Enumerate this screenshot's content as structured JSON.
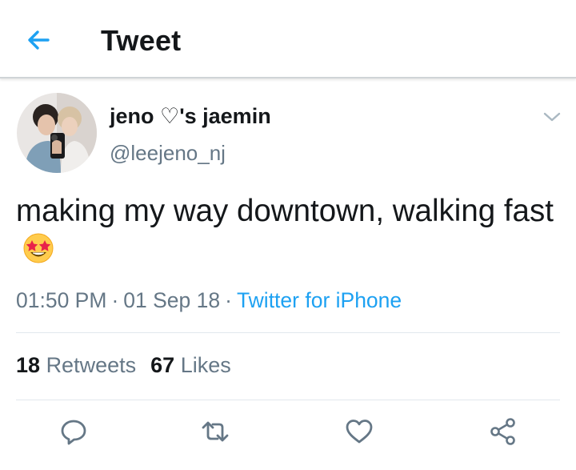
{
  "header": {
    "title": "Tweet",
    "back_icon": "arrow-left-icon",
    "accent_color": "#1da1f2"
  },
  "tweet": {
    "display_name": "jeno ♡'s jaemin",
    "username": "@leejeno_nj",
    "text": "making my way downtown, walking fast",
    "emoji": "star-struck-emoji",
    "time": "01:50 PM",
    "date": "01 Sep 18",
    "source": "Twitter for iPhone"
  },
  "stats": {
    "retweets_count": "18",
    "retweets_label": "Retweets",
    "likes_count": "67",
    "likes_label": "Likes"
  },
  "actions": [
    "reply-icon",
    "retweet-icon",
    "like-icon",
    "share-icon"
  ],
  "colors": {
    "text": "#14171a",
    "secondary": "#657786",
    "link": "#1da1f2",
    "divider": "#e1e8ed"
  }
}
